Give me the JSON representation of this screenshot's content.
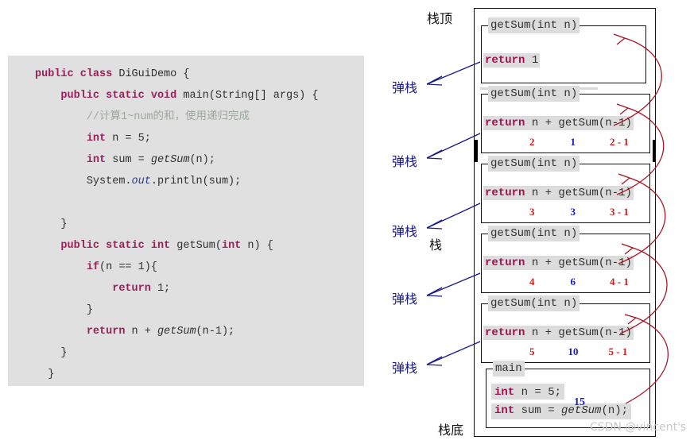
{
  "code_panel": {
    "lines": [
      "public class DiGuiDemo {",
      "    public static void main(String[] args) {",
      "        //计算1~num的和，使用递归完成",
      "        int n = 5;",
      "        int sum = getSum(n);",
      "        System.out.println(sum);",
      "",
      "    }",
      "    public static int getSum(int n) {",
      "        if(n == 1){",
      "            return 1;",
      "        }",
      "        return n + getSum(n-1);",
      "    }",
      "}"
    ]
  },
  "stack": {
    "top_label": "栈顶",
    "bottom_label": "栈底",
    "stack_label": "栈",
    "pop_label": "弹栈",
    "frames": [
      {
        "title": "getSum(int n)",
        "body_kw": "return",
        "body_rest": " 1",
        "nums": null
      },
      {
        "title": "getSum(int n)",
        "body_kw": "return",
        "body_rest": " n + getSum(n-1)",
        "nums": {
          "arg": "2",
          "value": "1",
          "expr": "2 - 1"
        }
      },
      {
        "title": "getSum(int n)",
        "body_kw": "return",
        "body_rest": " n + getSum(n-1)",
        "nums": {
          "arg": "3",
          "value": "3",
          "expr": "3 - 1"
        }
      },
      {
        "title": "getSum(int n)",
        "body_kw": "return",
        "body_rest": " n + getSum(n-1)",
        "nums": {
          "arg": "4",
          "value": "6",
          "expr": "4 - 1"
        }
      },
      {
        "title": "getSum(int n)",
        "body_kw": "return",
        "body_rest": " n + getSum(n-1)",
        "nums": {
          "arg": "5",
          "value": "10",
          "expr": "5 - 1"
        }
      }
    ],
    "main_frame": {
      "title": "main",
      "line1_kw": "int",
      "line1_rest": " n = 5;",
      "line2_kw": "int",
      "line2_rest_a": " sum = ",
      "line2_call": "getSum",
      "line2_rest_b": "(n);",
      "result": "15"
    }
  },
  "watermark": "CSDN @vincent's",
  "colors": {
    "keyword": "#9b1f5a",
    "comment": "#9aa89a",
    "red_num": "#d01b1b",
    "blue_num": "#1a1ad0",
    "arrow_blue": "#1a1a8c",
    "arrow_red": "#a81020",
    "code_bg": "#e0e0e0",
    "highlight_bg": "#dcdcdc"
  }
}
